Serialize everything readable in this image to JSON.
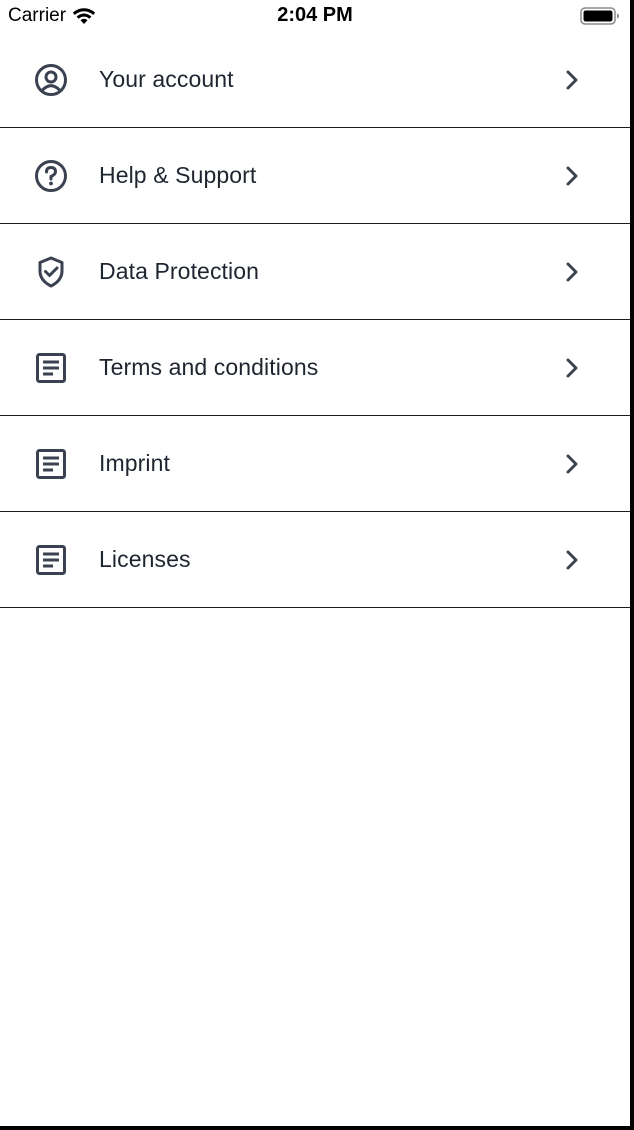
{
  "status_bar": {
    "carrier": "Carrier",
    "time": "2:04 PM"
  },
  "menu": {
    "items": [
      {
        "label": "Your account",
        "icon": "account-circle-icon"
      },
      {
        "label": "Help & Support",
        "icon": "help-circle-icon"
      },
      {
        "label": "Data Protection",
        "icon": "shield-check-icon"
      },
      {
        "label": "Terms and conditions",
        "icon": "document-icon"
      },
      {
        "label": "Imprint",
        "icon": "document-icon"
      },
      {
        "label": "Licenses",
        "icon": "document-icon"
      }
    ]
  },
  "colors": {
    "icon": "#3a4150",
    "text": "#1f2530",
    "divider": "#1a1a1a"
  }
}
